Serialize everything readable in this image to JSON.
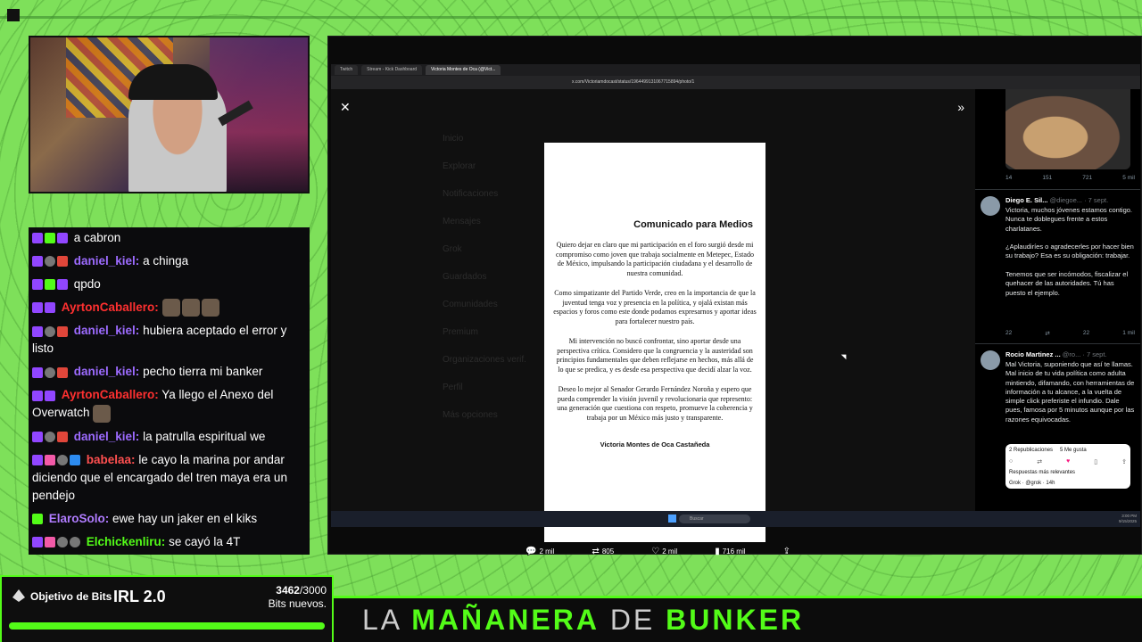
{
  "chat": {
    "lines": [
      {
        "user": "",
        "msg": "a cabron",
        "color": "u-purple"
      },
      {
        "user": "daniel_kiel:",
        "msg": "a chinga",
        "color": "u-purple"
      },
      {
        "user": "",
        "msg": "qpdo",
        "color": "u-purple"
      },
      {
        "user": "AyrtonCaballero:",
        "msg": "",
        "color": "u-red"
      },
      {
        "user": "daniel_kiel:",
        "msg": "hubiera aceptado el error y listo",
        "color": "u-purple"
      },
      {
        "user": "daniel_kiel:",
        "msg": "pecho tierra mi banker",
        "color": "u-purple"
      },
      {
        "user": "AyrtonCaballero:",
        "msg": "Ya llego el Anexo del Overwatch",
        "color": "u-red"
      },
      {
        "user": "daniel_kiel:",
        "msg": "la patrulla espiritual we",
        "color": "u-purple"
      },
      {
        "user": "babelaa:",
        "msg": "le cayo la marina por andar diciendo que el encargado del tren maya era un pendejo",
        "color": "u-pink"
      },
      {
        "user": "ElaroSolo:",
        "msg": "ewe hay un jaker en el kiks",
        "color": "u-violet"
      },
      {
        "user": "Elchickenliru:",
        "msg": "se cayó la 4T",
        "color": "u-green"
      },
      {
        "user": "",
        "msg": "",
        "color": "u-purple"
      }
    ]
  },
  "bits_goal": {
    "label": "Objetivo de Bits",
    "title": "IRL 2.0",
    "current": "3462",
    "target": "/3000",
    "subtitle": "Bits nuevos.",
    "progress": 1.0
  },
  "banner": {
    "w1": "LA",
    "w2": "MAÑANERA",
    "w3": "DE",
    "w4": "BUNKER"
  },
  "browser": {
    "tabs": [
      "Twitch",
      "Stream - Kick Dashboard",
      "Victoria Montes de Oca (@Vict..."
    ],
    "url": "x.com/Victoriamdocast/status/1964499131067715894/photo/1"
  },
  "sidebar_nav": [
    "Inicio",
    "Explorar",
    "Notificaciones",
    "Mensajes",
    "Grok",
    "Guardados",
    "Comunidades",
    "Premium",
    "Organizaciones verif.",
    "Perfil",
    "Más opciones"
  ],
  "document": {
    "title": "Comunicado para Medios",
    "paragraphs": [
      "Quiero dejar en claro que mi participación en el foro surgió desde mi compromiso como joven que trabaja socialmente en Metepec, Estado de México, impulsando la participación ciudadana y el desarrollo de nuestra comunidad.",
      "Como simpatizante del Partido Verde, creo en la importancia de que la juventud tenga voz y presencia en la política, y ojalá existan más espacios y foros como este donde podamos expresarnos y aportar ideas para fortalecer nuestro país.",
      "Mi intervención no buscó confrontar, sino aportar desde una perspectiva crítica. Considero que la congruencia y la austeridad son principios fundamentales que deben reflejarse en hechos, más allá de lo que se predica, y es desde esa perspectiva que decidí alzar la voz.",
      "Deseo lo mejor al Senador Gerardo Fernández Noroña y espero que pueda comprender la visión juvenil y revolucionaria que represento: una generación que cuestiona con respeto, promueve la coherencia y trabaja por un México más justo y transparente."
    ],
    "signature": "Victoria Montes de Oca Castañeda"
  },
  "post_stats": {
    "replies": "2 mil",
    "reposts": "805",
    "likes": "2 mil",
    "views": "716 mil"
  },
  "taskbar": {
    "search": "Buscar",
    "time": "3:00 PM",
    "date": "9/15/2025"
  },
  "tweets": {
    "first_actions": {
      "replies": "14",
      "reposts": "151",
      "likes": "721",
      "views": "5 mil"
    },
    "t1": {
      "name": "Diego E. Sil...",
      "handle": "@diegoe... · 7 sept.",
      "body": "Victoria, muchos jóvenes estamos contigo. Nunca te doblegues frente a estos charlatanes.\n\n¿Aplaudiríes o agradecerles por hacer bien su trabajo? Esa es su obligación: trabajar.\n\nTenemos que ser incómodos, fiscalizar el quehacer de las autoridades. Tú has puesto el ejemplo.",
      "actions": {
        "replies": "22",
        "reposts": "",
        "likes": "22",
        "views": "1 mil"
      }
    },
    "t2": {
      "name": "Rocio Martinez ...",
      "handle": "@ro... · 7 sept.",
      "body": "Mal Victoria, suponiendo que así te llamas. Mal inicio de tu vida política como adulta mintiendo, difamando, con herramientas de información a tu alcance, a la vuelta de simple click preferiste el infundio. Dale pues, famosa por 5 minutos aunque por las razones equivocadas."
    },
    "quote": {
      "reposts": "2 Republicaciones",
      "likes": "5 Me gusta",
      "sort": "Respuestas más relevantes",
      "grok": "Grok · @grok · 14h"
    }
  },
  "colors": {
    "background": "#7ee05a",
    "accent": "#53fc18",
    "panel": "#0b0b0d"
  }
}
